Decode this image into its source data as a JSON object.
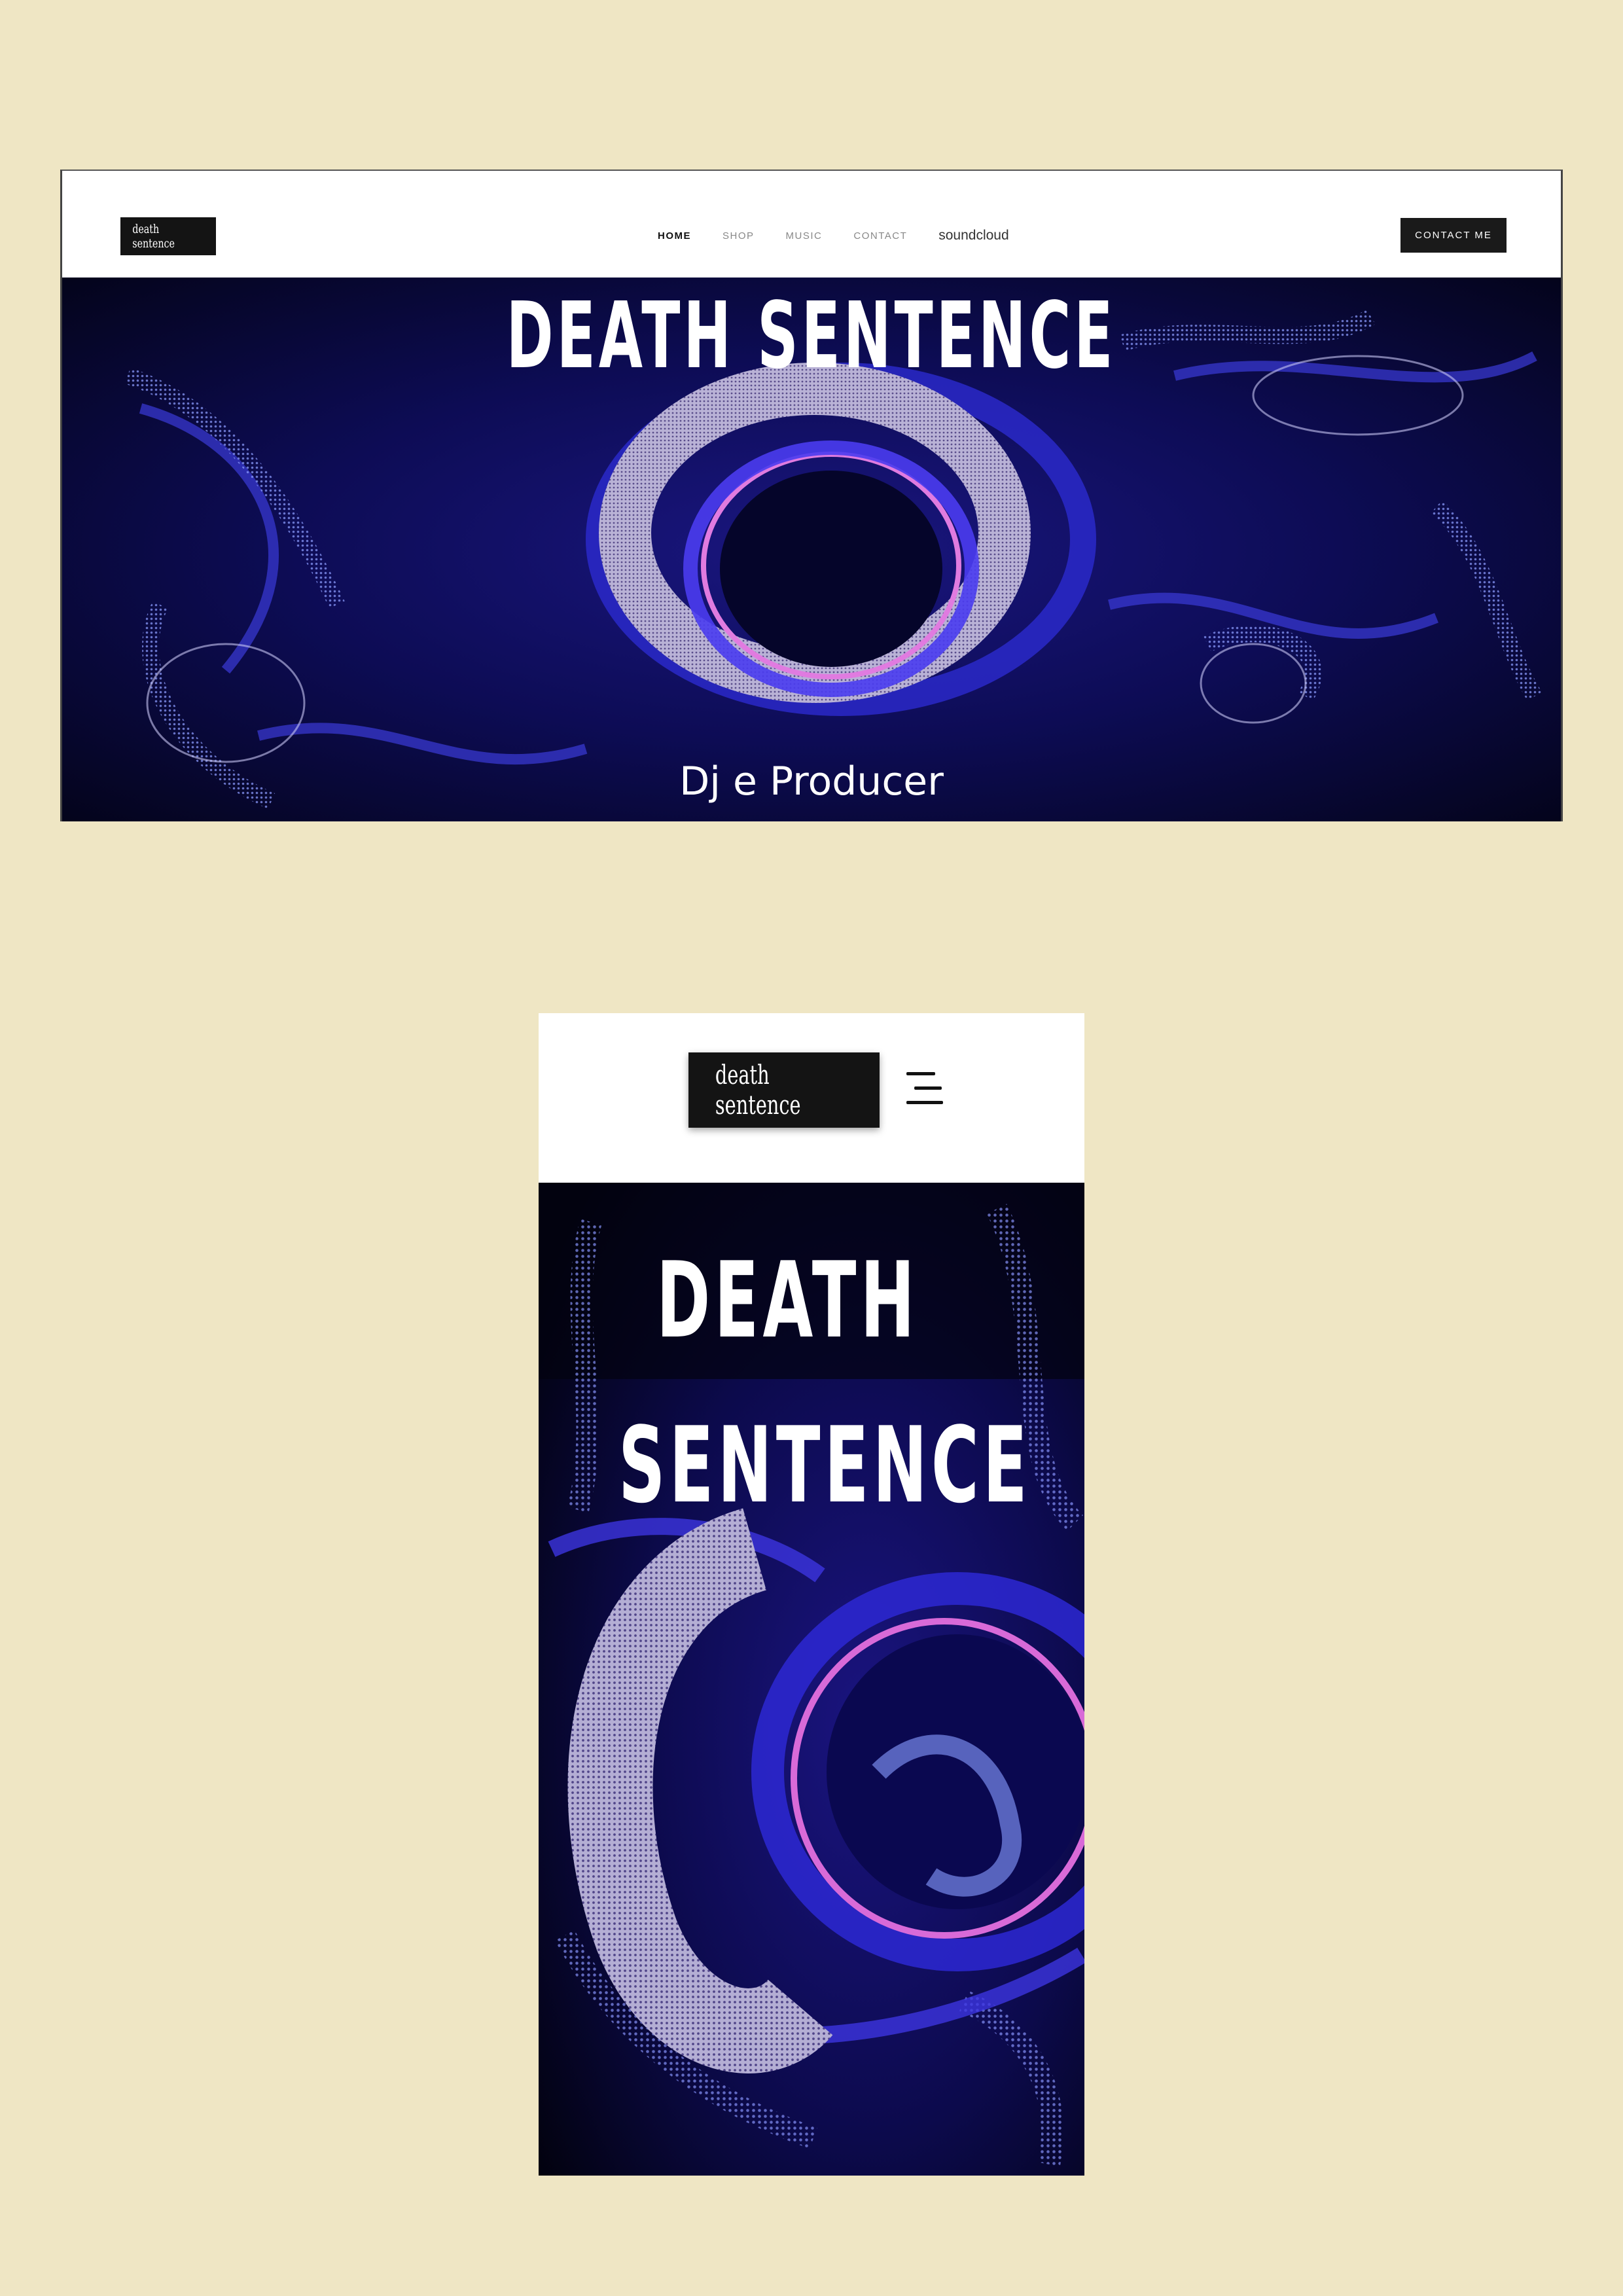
{
  "desktop": {
    "logo_text": "death sentence",
    "nav": {
      "items": [
        "HOME",
        "SHOP",
        "MUSIC",
        "CONTACT"
      ],
      "soundcloud": "soundcloud"
    },
    "contact_button": "CONTACT ME",
    "hero": {
      "title": "DEATH SENTENCE",
      "subtitle": "Dj e Producer"
    }
  },
  "mobile": {
    "logo_text": "death sentence",
    "hero": {
      "title_line1": "DEATH",
      "title_line2": "SENTENCE"
    }
  },
  "colors": {
    "background": "#efe6c4",
    "hero_dark": "#0a0a3a",
    "accent_blue": "#3a2bd6",
    "accent_pink": "#e060d0",
    "button": "#1a1a1a"
  },
  "icons": [
    "hamburger-menu-icon"
  ]
}
